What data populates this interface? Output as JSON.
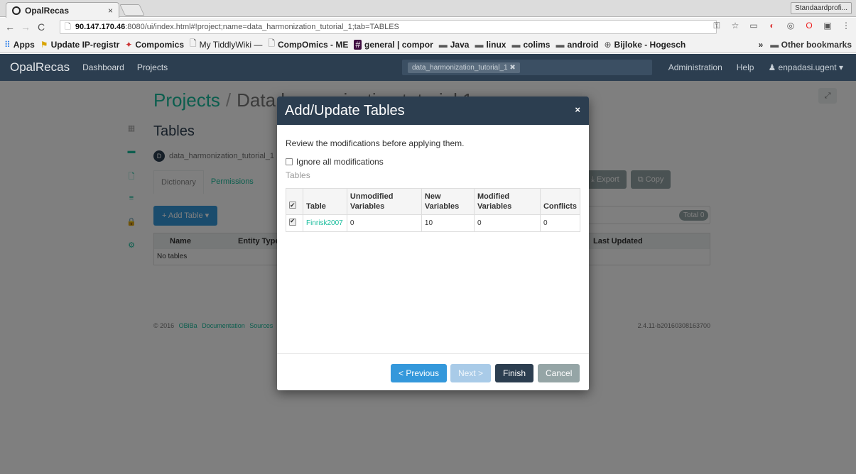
{
  "browser": {
    "tab_title": "OpalRecas",
    "tab_close": "×",
    "profile_label": "Standaardprofi...",
    "url_host": "90.147.170.46",
    "url_rest": ":8080/ui/index.html#!project;name=data_harmonization_tutorial_1;tab=TABLES",
    "bookmarks": [
      {
        "label": "Apps",
        "icon": "apps-grid-icon"
      },
      {
        "label": "Update IP-registr",
        "icon": "bookmark-icon"
      },
      {
        "label": "Compomics",
        "icon": "bookmark-icon"
      },
      {
        "label": "My TiddlyWiki —",
        "icon": "page-icon"
      },
      {
        "label": "CompOmics - ME",
        "icon": "page-icon"
      },
      {
        "label": "general | compor",
        "icon": "slack-icon"
      },
      {
        "label": "Java",
        "icon": "folder-icon"
      },
      {
        "label": "linux",
        "icon": "folder-icon"
      },
      {
        "label": "colims",
        "icon": "folder-icon"
      },
      {
        "label": "android",
        "icon": "folder-icon"
      },
      {
        "label": "Bijloke - Hogesch",
        "icon": "globe-icon"
      }
    ],
    "more_bookmarks": "»",
    "other_bookmarks": "Other bookmarks"
  },
  "navbar": {
    "brand": "OpalRecas",
    "links": [
      "Dashboard",
      "Projects"
    ],
    "search_token": "data_harmonization_tutorial_1",
    "right_links": [
      "Administration",
      "Help"
    ],
    "user": "enpadasi.ugent"
  },
  "page": {
    "crumb_root": "Projects",
    "crumb_sep": "/",
    "crumb_current": "Data harmonization tutorial 1",
    "section_title": "Tables",
    "datasource_badge": "D",
    "datasource_name": "data_harmonization_tutorial_1",
    "subtabs": [
      "Dictionary",
      "Permissions"
    ],
    "action_buttons": [
      "Export",
      "Copy"
    ],
    "add_table": "+ Add Table ▾",
    "total_badge": "Total 0",
    "table_headers": [
      "Name",
      "Entity Type",
      "Last Updated"
    ],
    "empty_row": "No tables",
    "footer_copyright": "© 2016",
    "footer_links": [
      "OBiBa",
      "Documentation",
      "Sources"
    ],
    "footer_version": "2.4.11-b20160308163700"
  },
  "modal": {
    "title": "Add/Update Tables",
    "close": "×",
    "review_text": "Review the modifications before applying them.",
    "ignore_label": "Ignore all modifications",
    "tables_label": "Tables",
    "columns": [
      "Table",
      "Unmodified Variables",
      "New Variables",
      "Modified Variables",
      "Conflicts"
    ],
    "rows": [
      {
        "checked": true,
        "table": "Finrisk2007",
        "unmodified": "0",
        "new": "10",
        "modified": "0",
        "conflicts": "0"
      }
    ],
    "buttons": {
      "previous": "< Previous",
      "next": "Next >",
      "finish": "Finish",
      "cancel": "Cancel"
    }
  },
  "colors": {
    "navbar": "#2c3e50",
    "accent_green": "#18bc9c",
    "primary_blue": "#3498db",
    "gray_button": "#95a5a6"
  }
}
